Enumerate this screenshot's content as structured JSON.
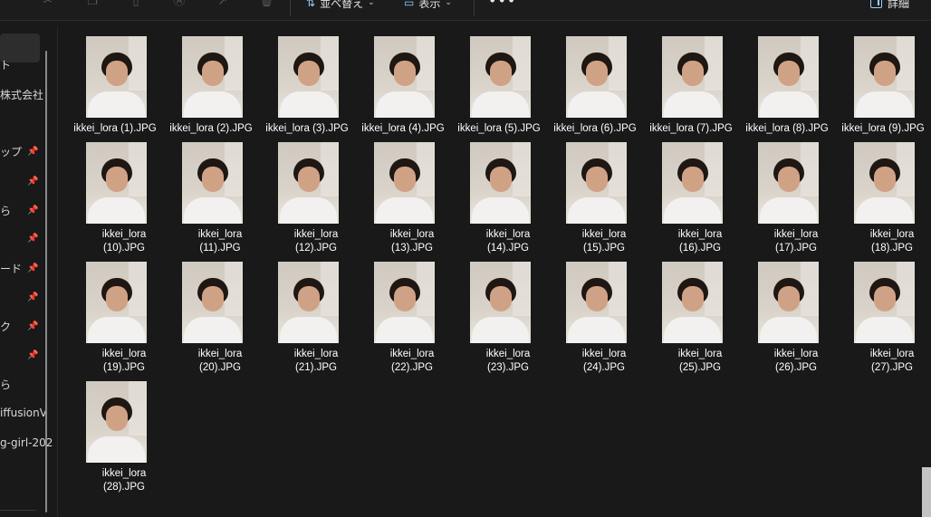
{
  "toolbar": {
    "icons": [
      "cut-icon",
      "copy-icon",
      "paste-icon",
      "rename-icon",
      "share-icon",
      "delete-icon"
    ],
    "sort_label": "並べ替え",
    "view_label": "表示",
    "more_label": "•••",
    "details_label": "詳細"
  },
  "sidebar": {
    "items": [
      {
        "label": "ト",
        "pinned": false
      },
      {
        "label": "株式会社",
        "pinned": false
      },
      {
        "label": "ップ",
        "pinned": true
      },
      {
        "label": "",
        "pinned": true
      },
      {
        "label": "ら",
        "pinned": true
      },
      {
        "label": "",
        "pinned": true
      },
      {
        "label": "ード",
        "pinned": true
      },
      {
        "label": "",
        "pinned": true
      },
      {
        "label": "ク",
        "pinned": true
      },
      {
        "label": "",
        "pinned": true
      },
      {
        "label": "ら",
        "pinned": false
      },
      {
        "label": "iffusionV",
        "pinned": false
      },
      {
        "label": "g-girl-202",
        "pinned": false
      }
    ]
  },
  "files": [
    {
      "name": "ikkei_lora (1).JPG"
    },
    {
      "name": "ikkei_lora (2).JPG"
    },
    {
      "name": "ikkei_lora (3).JPG"
    },
    {
      "name": "ikkei_lora (4).JPG"
    },
    {
      "name": "ikkei_lora (5).JPG"
    },
    {
      "name": "ikkei_lora (6).JPG"
    },
    {
      "name": "ikkei_lora (7).JPG"
    },
    {
      "name": "ikkei_lora (8).JPG"
    },
    {
      "name": "ikkei_lora (9).JPG"
    },
    {
      "name": "ikkei_lora\n(10).JPG"
    },
    {
      "name": "ikkei_lora\n(11).JPG"
    },
    {
      "name": "ikkei_lora\n(12).JPG"
    },
    {
      "name": "ikkei_lora\n(13).JPG"
    },
    {
      "name": "ikkei_lora\n(14).JPG"
    },
    {
      "name": "ikkei_lora\n(15).JPG"
    },
    {
      "name": "ikkei_lora\n(16).JPG"
    },
    {
      "name": "ikkei_lora\n(17).JPG"
    },
    {
      "name": "ikkei_lora\n(18).JPG"
    },
    {
      "name": "ikkei_lora\n(19).JPG"
    },
    {
      "name": "ikkei_lora\n(20).JPG"
    },
    {
      "name": "ikkei_lora\n(21).JPG"
    },
    {
      "name": "ikkei_lora\n(22).JPG"
    },
    {
      "name": "ikkei_lora\n(23).JPG"
    },
    {
      "name": "ikkei_lora\n(24).JPG"
    },
    {
      "name": "ikkei_lora\n(25).JPG"
    },
    {
      "name": "ikkei_lora\n(26).JPG"
    },
    {
      "name": "ikkei_lora\n(27).JPG"
    },
    {
      "name": "ikkei_lora\n(28).JPG"
    }
  ]
}
